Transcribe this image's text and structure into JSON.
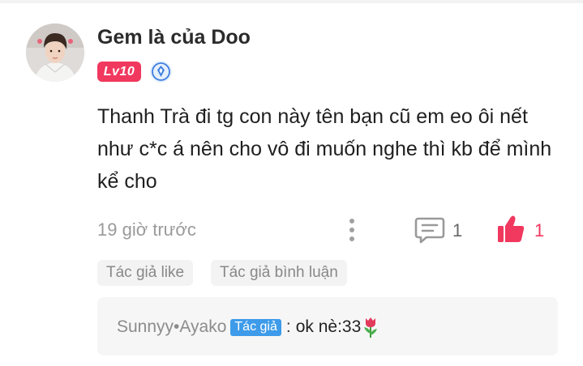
{
  "comment": {
    "username": "Gem là của Doo",
    "level": "Lv10",
    "text": "Thanh Trà đi tg con này tên bạn cũ em eo ôi nết như c*c á nên cho vô đi muốn nghe thì kb để mình kể cho",
    "timestamp": "19 giờ trước",
    "reply_count": "1",
    "like_count": "1",
    "tags": [
      "Tác giả like",
      "Tác giả bình luận"
    ]
  },
  "reply": {
    "username": "Sunnyy•Ayako",
    "author_badge": "Tác giả",
    "separator": ":",
    "text": "ok nè:33"
  },
  "icons": {
    "verify": "verified-badge-icon",
    "more": "more-vertical-icon",
    "reply": "comment-icon",
    "like": "thumbs-up-icon",
    "emoji": "tulip-icon"
  },
  "colors": {
    "accent": "#f1385e",
    "author_badge": "#3d9be9",
    "verify": "#3d7de0"
  }
}
